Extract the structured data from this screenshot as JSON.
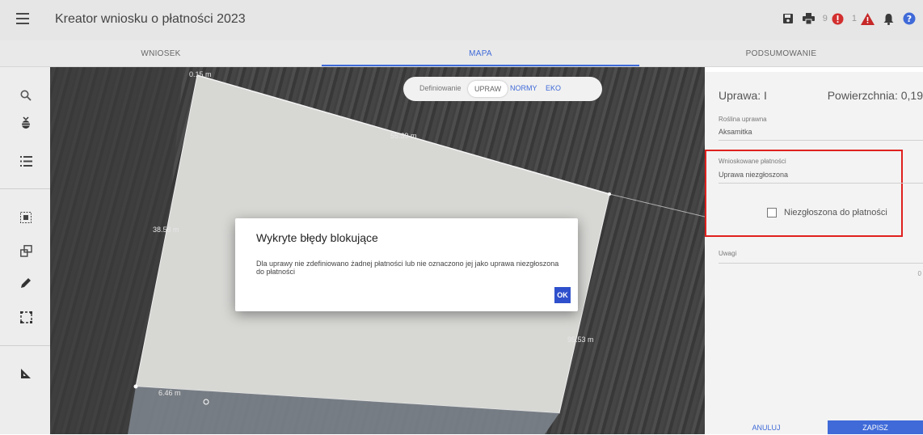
{
  "app": {
    "title": "Kreator wniosku o płatności 2023"
  },
  "topbar": {
    "icons": [
      "menu-icon",
      "save-icon",
      "print-icon",
      "error-icon",
      "warning-icon",
      "bell-icon",
      "help-icon"
    ],
    "error_count": "9",
    "warning_count": "1",
    "colors": {
      "error": "#d32f2f",
      "warning": "#c62828",
      "help": "#3f6ad8"
    }
  },
  "tabs": [
    {
      "label": "WNIOSEK",
      "active": false
    },
    {
      "label": "MAPA",
      "active": true
    },
    {
      "label": "PODSUMOWANIE",
      "active": false
    }
  ],
  "sidebar": {
    "icons": [
      "search-icon",
      "crop-plant-icon",
      "list-icon",
      "select-area-icon",
      "copy-shape-icon",
      "draw-icon",
      "rectangle-select-icon",
      "measure-icon"
    ]
  },
  "map": {
    "toggle": {
      "prefix": "Definiowanie",
      "options": [
        "UPRAW",
        "NORMY",
        "EKO"
      ],
      "selected": "UPRAW"
    },
    "dimensions": [
      "0.15 m",
      "55.39 m",
      "38.58 m",
      "95.53 m",
      "6.46 m"
    ]
  },
  "dialog": {
    "title": "Wykryte błędy blokujące",
    "message": "Dla uprawy nie zdefiniowano żadnej płatności lub nie oznaczono jej jako uprawa niezgłoszona do płatności",
    "ok": "OK"
  },
  "panel": {
    "title": "Uprawa: I",
    "area": "Powierzchnia: 0,19",
    "crop_label": "Roślina uprawna",
    "crop_value": "Aksamitka",
    "payments_label": "Wnioskowane płatności",
    "payments_value": "Uprawa niezgłoszona",
    "checkbox_label": "Niezgłoszona do płatności",
    "checkbox_checked": false,
    "notes_label": "Uwagi",
    "notes_counter": "0",
    "cancel": "ANULUJ",
    "save": "ZAPISZ",
    "accent": "#3f6ad8",
    "highlight": "#e0201e"
  }
}
